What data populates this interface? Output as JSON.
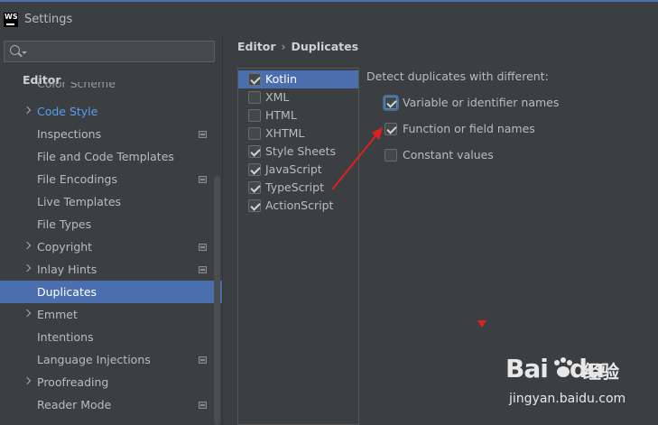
{
  "window": {
    "title": "Settings",
    "logo_text": "WS"
  },
  "sidebar": {
    "search_placeholder": "",
    "group_title": "Editor",
    "cut_item": "Color Scheme",
    "items": [
      {
        "label": "Code Style",
        "arrow": true,
        "link": true,
        "project": false,
        "selected": false
      },
      {
        "label": "Inspections",
        "arrow": false,
        "link": false,
        "project": true,
        "selected": false
      },
      {
        "label": "File and Code Templates",
        "arrow": false,
        "link": false,
        "project": false,
        "selected": false
      },
      {
        "label": "File Encodings",
        "arrow": false,
        "link": false,
        "project": true,
        "selected": false
      },
      {
        "label": "Live Templates",
        "arrow": false,
        "link": false,
        "project": false,
        "selected": false
      },
      {
        "label": "File Types",
        "arrow": false,
        "link": false,
        "project": false,
        "selected": false
      },
      {
        "label": "Copyright",
        "arrow": true,
        "link": false,
        "project": true,
        "selected": false
      },
      {
        "label": "Inlay Hints",
        "arrow": true,
        "link": false,
        "project": true,
        "selected": false
      },
      {
        "label": "Duplicates",
        "arrow": false,
        "link": false,
        "project": false,
        "selected": true
      },
      {
        "label": "Emmet",
        "arrow": true,
        "link": false,
        "project": false,
        "selected": false
      },
      {
        "label": "Intentions",
        "arrow": false,
        "link": false,
        "project": false,
        "selected": false
      },
      {
        "label": "Language Injections",
        "arrow": false,
        "link": false,
        "project": true,
        "selected": false
      },
      {
        "label": "Proofreading",
        "arrow": true,
        "link": false,
        "project": false,
        "selected": false
      },
      {
        "label": "Reader Mode",
        "arrow": false,
        "link": false,
        "project": true,
        "selected": false
      }
    ]
  },
  "breadcrumb": {
    "parent": "Editor",
    "separator": "›",
    "current": "Duplicates"
  },
  "languages": [
    {
      "label": "Kotlin",
      "checked": true,
      "selected": true
    },
    {
      "label": "XML",
      "checked": false,
      "selected": false
    },
    {
      "label": "HTML",
      "checked": false,
      "selected": false
    },
    {
      "label": "XHTML",
      "checked": false,
      "selected": false
    },
    {
      "label": "Style Sheets",
      "checked": true,
      "selected": false
    },
    {
      "label": "JavaScript",
      "checked": true,
      "selected": false
    },
    {
      "label": "TypeScript",
      "checked": true,
      "selected": false
    },
    {
      "label": "ActionScript",
      "checked": true,
      "selected": false
    }
  ],
  "detect": {
    "title": "Detect duplicates with different:",
    "options": [
      {
        "label": "Variable or identifier names",
        "checked": true,
        "focused": true
      },
      {
        "label": "Function or field names",
        "checked": true,
        "focused": false
      },
      {
        "label": "Constant values",
        "checked": false,
        "focused": false
      }
    ]
  },
  "watermark": {
    "logo": "Bai",
    "logo_tail": "du",
    "cn": "经验",
    "url": "jingyan.baidu.com"
  },
  "colors": {
    "selection": "#4b6eaf",
    "link": "#589df6",
    "annotation": "#e02020"
  }
}
